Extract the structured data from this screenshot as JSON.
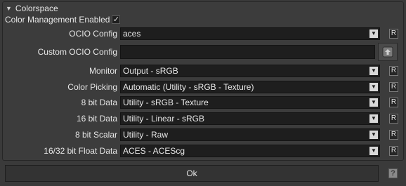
{
  "section": {
    "title": "Colorspace",
    "collapse_icon": "triangle-down"
  },
  "color_management": {
    "label": "Color Management Enabled",
    "checked": true,
    "check_glyph": "✓"
  },
  "ocio_config": {
    "label": "OCIO Config",
    "value": "aces",
    "reset_label": "R"
  },
  "custom_ocio_config": {
    "label": "Custom OCIO Config",
    "value": "",
    "button_icon": "file-browse-icon"
  },
  "monitor": {
    "label": "Monitor",
    "value": "Output - sRGB",
    "reset_label": "R"
  },
  "color_picking": {
    "label": "Color Picking",
    "value": "Automatic (Utility - sRGB - Texture)",
    "reset_label": "R"
  },
  "eight_bit_data": {
    "label": "8 bit Data",
    "value": "Utility - sRGB - Texture",
    "reset_label": "R"
  },
  "sixteen_bit_data": {
    "label": "16 bit Data",
    "value": "Utility - Linear - sRGB",
    "reset_label": "R"
  },
  "eight_bit_scalar": {
    "label": "8 bit Scalar",
    "value": "Utility - Raw",
    "reset_label": "R"
  },
  "float_data": {
    "label": "16/32 bit Float Data",
    "value": "ACES - ACEScg",
    "reset_label": "R"
  },
  "footer": {
    "ok_label": "Ok",
    "help_label": "?"
  }
}
